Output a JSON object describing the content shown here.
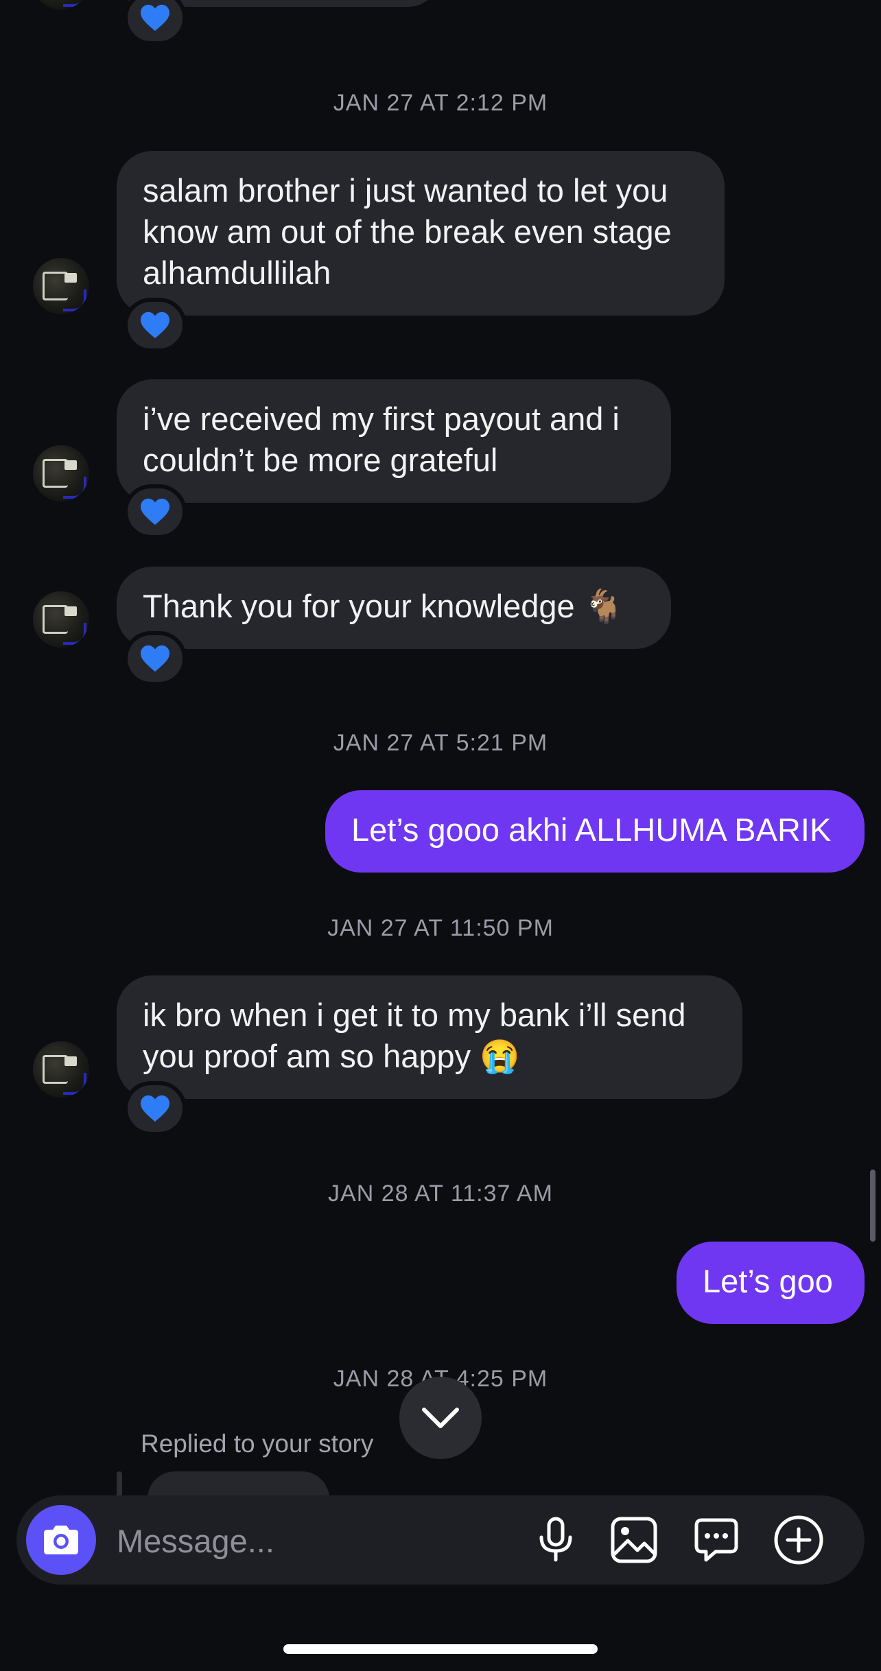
{
  "thread": {
    "messages": [
      {
        "timestamp": "JAN 27 AT 2:12 PM",
        "text": "salam brother i just wanted to let you\nknow am out of the break even stage\nalhamdullilah",
        "reaction": "blue-heart"
      },
      {
        "text": "i’ve received my first payout and i\ncouldn’t be more grateful",
        "reaction": "blue-heart"
      },
      {
        "text": "Thank you for your knowledge 🐐",
        "reaction": "blue-heart"
      },
      {
        "timestamp": "JAN 27 AT 5:21 PM",
        "text": "Let’s gooo akhi ALLHUMA BARIK"
      },
      {
        "timestamp": "JAN 27 AT 11:50 PM",
        "text": "ik bro when i get it to my bank i’ll send\nyou proof am so happy 😭",
        "reaction": "blue-heart"
      },
      {
        "timestamp": "JAN 28 AT 11:37 AM",
        "text": "Let’s goo"
      },
      {
        "timestamp": "JAN 28 AT 4:25 PM",
        "story_label": "Replied to your story"
      }
    ]
  },
  "composer": {
    "placeholder": "Message..."
  },
  "colors": {
    "background": "#0c0d11",
    "incoming_bubble": "#26272c",
    "outgoing_bubble": "#7037f3",
    "camera_button": "#5b51f6",
    "reaction_heart": "#2f7df6"
  }
}
